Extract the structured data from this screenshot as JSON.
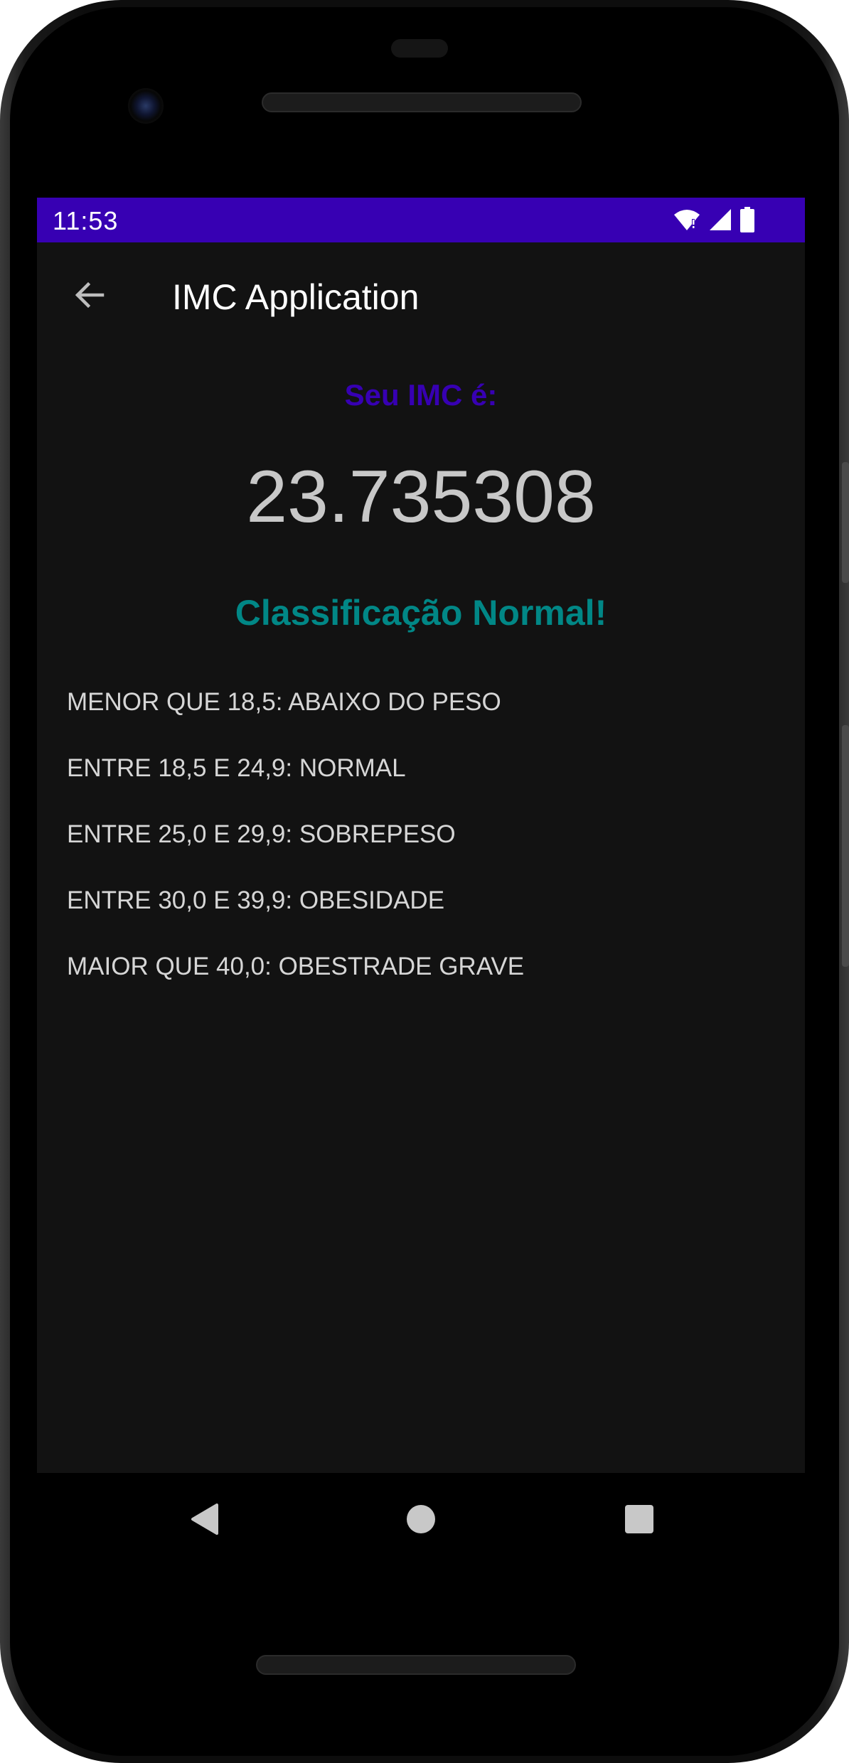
{
  "status_bar": {
    "time": "11:53",
    "background": "#3700b3",
    "icons": [
      "wifi-icon",
      "signal-icon",
      "battery-icon"
    ]
  },
  "app_bar": {
    "back_icon": "arrow-left-icon",
    "title": "IMC Application"
  },
  "result": {
    "label": "Seu IMC é:",
    "label_color": "#3700b3",
    "value": "23.735308",
    "classification": "Classificação Normal!",
    "classification_color": "#018786"
  },
  "ranges": [
    "MENOR QUE 18,5: ABAIXO DO PESO",
    "ENTRE 18,5 E 24,9: NORMAL",
    "ENTRE 25,0 E 29,9: SOBREPESO",
    "ENTRE 30,0 E 39,9: OBESIDADE",
    "MAIOR QUE 40,0: OBESTRADE GRAVE"
  ],
  "nav_bar": {
    "icons": [
      "back-triangle-icon",
      "home-circle-icon",
      "recents-square-icon"
    ]
  }
}
